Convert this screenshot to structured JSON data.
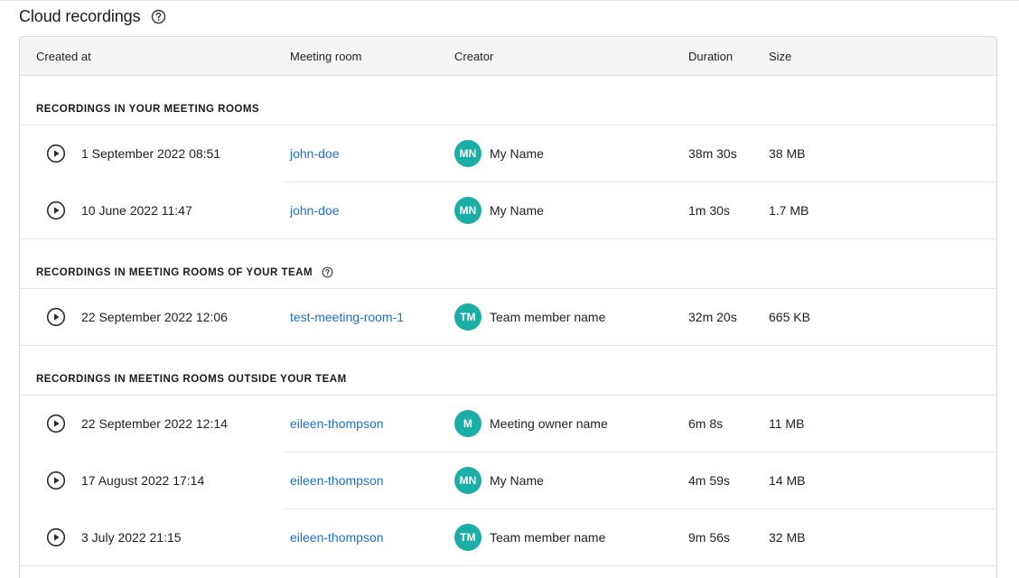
{
  "page": {
    "title": "Cloud recordings",
    "help_icon": "question-circle-icon"
  },
  "table": {
    "columns": [
      "Created at",
      "Meeting room",
      "Creator",
      "Duration",
      "Size"
    ],
    "sections": [
      {
        "label": "RECORDINGS IN YOUR MEETING ROOMS",
        "has_help": false,
        "rows": [
          {
            "created_at": "1 September 2022 08:51",
            "room": "john-doe",
            "initials": "MN",
            "creator": "My Name",
            "duration": "38m 30s",
            "size": "38 MB"
          },
          {
            "created_at": "10 June 2022 11:47",
            "room": "john-doe",
            "initials": "MN",
            "creator": "My Name",
            "duration": "1m 30s",
            "size": "1.7 MB"
          }
        ]
      },
      {
        "label": "RECORDINGS IN MEETING ROOMS OF YOUR TEAM",
        "has_help": true,
        "rows": [
          {
            "created_at": "22 September 2022 12:06",
            "room": "test-meeting-room-1",
            "initials": "TM",
            "creator": "Team member name",
            "duration": "32m 20s",
            "size": "665 KB"
          }
        ]
      },
      {
        "label": "RECORDINGS IN MEETING ROOMS OUTSIDE YOUR TEAM",
        "has_help": false,
        "rows": [
          {
            "created_at": "22 September 2022 12:14",
            "room": "eileen-thompson",
            "initials": "M",
            "creator": "Meeting owner name",
            "duration": "6m 8s",
            "size": "11 MB"
          },
          {
            "created_at": "17 August 2022 17:14",
            "room": "eileen-thompson",
            "initials": "MN",
            "creator": "My Name",
            "duration": "4m 59s",
            "size": "14 MB"
          },
          {
            "created_at": "3 July 2022 21:15",
            "room": "eileen-thompson",
            "initials": "TM",
            "creator": "Team member name",
            "duration": "9m 56s",
            "size": "32 MB"
          }
        ]
      }
    ]
  },
  "colors": {
    "avatar": "#1aaea6",
    "link": "#1f6fd0",
    "header_bg": "#f5f5f5"
  },
  "icons": {
    "play": "play-circle-icon",
    "help": "question-circle-icon"
  }
}
